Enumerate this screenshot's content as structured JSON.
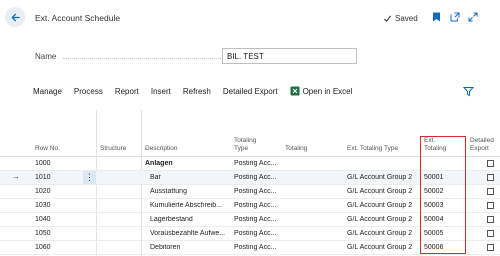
{
  "window": {
    "title": "Ext. Account Schedule",
    "saved_label": "Saved"
  },
  "icons": {
    "back": "arrow-left-icon",
    "saved": "check-icon",
    "bookmark": "bookmark-icon",
    "open_new": "open-new-window-icon",
    "expand": "expand-icon",
    "excel": "excel-icon",
    "filter": "filter-icon"
  },
  "colors": {
    "accent": "#0f6cbd",
    "highlight": "#d52b2b",
    "back_bg": "#e8eef6"
  },
  "form": {
    "name_label": "Name",
    "name_value": "BIL. TEST"
  },
  "actions": [
    "Manage",
    "Process",
    "Report",
    "Insert",
    "Refresh",
    "Detailed Export"
  ],
  "open_in_excel": "Open in Excel",
  "table": {
    "headers": {
      "row_no": "Row No.",
      "structure": "Structure",
      "description": "Description",
      "totaling_type_1": "Totaling",
      "totaling_type_2": "Type",
      "totaling": "Totaling",
      "ext_totaling_type": "Ext. Totaling Type",
      "ext_totaling_1": "Ext.",
      "ext_totaling_2": "Totaling",
      "detailed_export_1": "Detailed",
      "detailed_export_2": "Export"
    },
    "rows": [
      {
        "row_no": "1000",
        "description": "Anlagen",
        "totaling_type": "Posting Acc...",
        "ext_totaling_type": "",
        "ext_totaling": "",
        "bold": true
      },
      {
        "row_no": "1010",
        "description": "Bar",
        "totaling_type": "Posting Acc...",
        "ext_totaling_type": "G/L Account Group 2",
        "ext_totaling": "50001",
        "selected": true
      },
      {
        "row_no": "1020",
        "description": "Ausstattung",
        "totaling_type": "Posting Acc...",
        "ext_totaling_type": "G/L Account Group 2",
        "ext_totaling": "50002"
      },
      {
        "row_no": "1030",
        "description": "Kumulierte Abschreib...",
        "totaling_type": "Posting Acc...",
        "ext_totaling_type": "G/L Account Group 2",
        "ext_totaling": "50003"
      },
      {
        "row_no": "1040",
        "description": "Lagerbestand",
        "totaling_type": "Posting Acc...",
        "ext_totaling_type": "G/L Account Group 2",
        "ext_totaling": "50004"
      },
      {
        "row_no": "1050",
        "description": "Vorausbezahlte Aufwe...",
        "totaling_type": "Posting Acc...",
        "ext_totaling_type": "G/L Account Group 2",
        "ext_totaling": "50005"
      },
      {
        "row_no": "1060",
        "description": "Debitoren",
        "totaling_type": "Posting Acc...",
        "ext_totaling_type": "G/L Account Group 2",
        "ext_totaling": "50006"
      }
    ]
  }
}
